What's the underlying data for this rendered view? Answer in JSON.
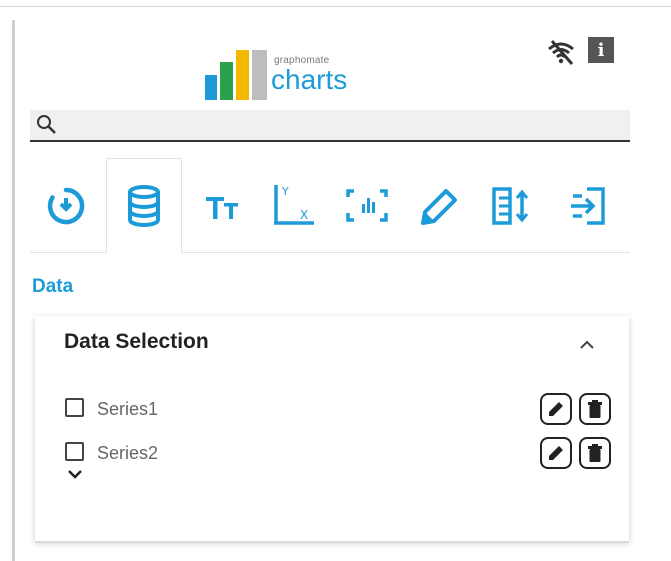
{
  "colors": {
    "accent": "#1c9bd8",
    "dark": "#555555"
  },
  "logo": {
    "small_text": "graphomate",
    "big_text": "charts"
  },
  "header_icons": [
    "wifi-off-icon",
    "info-icon"
  ],
  "info_label": "i",
  "search": {
    "placeholder": "",
    "value": ""
  },
  "tabs": [
    {
      "name": "tab-timer",
      "icon": "timer-icon",
      "active": false
    },
    {
      "name": "tab-data",
      "icon": "database-icon",
      "active": true
    },
    {
      "name": "tab-text",
      "icon": "text-size-icon",
      "active": false
    },
    {
      "name": "tab-axes",
      "icon": "axes-icon",
      "active": false
    },
    {
      "name": "tab-chart-layout",
      "icon": "chart-layout-icon",
      "active": false
    },
    {
      "name": "tab-pencil",
      "icon": "pencil-icon",
      "active": false
    },
    {
      "name": "tab-sort",
      "icon": "sort-icon",
      "active": false
    },
    {
      "name": "tab-import",
      "icon": "import-icon",
      "active": false
    }
  ],
  "section": {
    "title": "Data"
  },
  "data_selection": {
    "title": "Data Selection",
    "series": [
      {
        "label": "Series1",
        "checked": false
      },
      {
        "label": "Series2",
        "checked": false
      }
    ]
  }
}
